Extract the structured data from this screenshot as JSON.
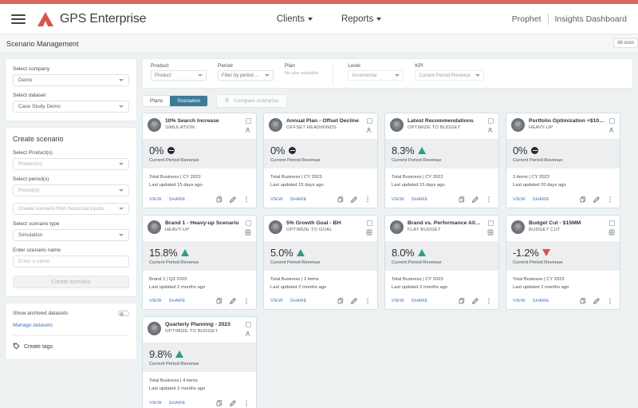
{
  "header": {
    "menu_icon": "hamburger-icon",
    "brand": "GPS Enterprise",
    "nav": [
      {
        "label": "Clients",
        "icon": "chevron-down-icon"
      },
      {
        "label": "Reports",
        "icon": "chevron-down-icon"
      }
    ],
    "right": {
      "prophet": "Prophet",
      "insights": "Insights Dashboard"
    }
  },
  "subheader": {
    "title": "Scenario Management",
    "scope_chip": "All scen"
  },
  "sidebar": {
    "company": {
      "label": "Select company",
      "value": "Demo"
    },
    "dataset": {
      "label": "Select dataset",
      "value": "Case Study Demo"
    },
    "create": {
      "title": "Create scenario",
      "product_label": "Select Product(s)",
      "product_value": "Product(s)",
      "period_label": "Select period(s)",
      "period_value": "Period(s)",
      "historical_value": "Create scenario from historical inputs",
      "type_label": "Select scenario type",
      "type_value": "Simulation",
      "name_label": "Enter scenario name",
      "name_placeholder": "Enter a name",
      "submit_label": "Create scenario"
    },
    "footer": {
      "archived_label": "Show archived datasets",
      "manage_link": "Manage datasets",
      "tags_label": "Create tags",
      "tags_icon": "tag-icon"
    }
  },
  "filters": {
    "product": {
      "label": "Product",
      "value": "Product"
    },
    "period": {
      "label": "Period",
      "value": "Filter by period ..."
    },
    "plan": {
      "label": "Plan",
      "note": "No plan available"
    },
    "level": {
      "label": "Level",
      "value": "Incremental"
    },
    "kpi": {
      "label": "KPI",
      "value": "Current Period Revenue"
    }
  },
  "tabs": {
    "plans": "Plans",
    "scenarios": "Scenarios",
    "active": "Scenarios",
    "compare": "Compare scenarios",
    "compare_icon": "compare-icon"
  },
  "card_actions": {
    "view": "VIEW",
    "share": "SHARE",
    "copy_icon": "copy-icon",
    "edit_icon": "pencil-icon",
    "more_icon": "more-vertical-icon"
  },
  "cards": [
    {
      "title": "10% Search Increase",
      "subtitle": "SIMULATION",
      "value": "0%",
      "trend": "flat",
      "metric_caption": "Current Period Revenue",
      "scope": "Total Business | CY 2023",
      "updated": "Last updated 15 days ago",
      "share_icon": "person-share-icon"
    },
    {
      "title": "Annual Plan - Offset Decline",
      "subtitle": "OFFSET HEADWINDS",
      "value": "0%",
      "trend": "flat",
      "metric_caption": "Current Period Revenue",
      "scope": "Total Business | CY 2023",
      "updated": "Last updated 15 days ago",
      "share_icon": "person-share-icon"
    },
    {
      "title": "Latest Recommendations",
      "subtitle": "OPTIMIZE TO BUDGET",
      "value": "8.3%",
      "trend": "up",
      "metric_caption": "Current Period Revenue",
      "scope": "Total Business | CY 2022",
      "updated": "Last updated 15 days ago",
      "share_icon": "person-share-icon"
    },
    {
      "title": "Portfolio Optimization +$10M...",
      "subtitle": "HEAVY-UP",
      "value": "0%",
      "trend": "flat",
      "metric_caption": "Current Period Revenue",
      "scope": "3 items | CY 2023",
      "updated": "Last updated 20 days ago",
      "share_icon": "person-share-icon"
    },
    {
      "title": "Brand 1 - Heavy-up Scenario",
      "subtitle": "HEAVY-UP",
      "value": "15.8%",
      "trend": "up",
      "metric_caption": "Current Period Revenue",
      "scope": "Brand 1 | Q3 2023",
      "updated": "Last updated 2 months ago",
      "share_icon": "grid-share-icon"
    },
    {
      "title": "5% Growth Goal - BH",
      "subtitle": "OPTIMIZE TO GOAL",
      "value": "5.0%",
      "trend": "up",
      "metric_caption": "Current Period Revenue",
      "scope": "Total Business | 2 items",
      "updated": "Last updated 2 months ago",
      "share_icon": "grid-share-icon"
    },
    {
      "title": "Brand vs. Performance Allocati...",
      "subtitle": "FLAT BUDGET",
      "value": "8.0%",
      "trend": "up",
      "metric_caption": "Current Period Revenue",
      "scope": "Total Business | CY 2023",
      "updated": "Last updated 2 months ago",
      "share_icon": "grid-share-icon"
    },
    {
      "title": "Budget Cut - $15MM",
      "subtitle": "BUDGET CUT",
      "value": "-1.2%",
      "trend": "down",
      "metric_caption": "Current Period Revenue",
      "scope": "Total Business | CY 2023",
      "updated": "Last updated 2 months ago",
      "share_icon": "grid-share-icon"
    },
    {
      "title": "Quarterly Planning - 2023",
      "subtitle": "OPTIMIZE TO BUDGET",
      "value": "9.8%",
      "trend": "up",
      "metric_caption": "Current Period Revenue",
      "scope": "Total Business | 4 items",
      "updated": "Last updated 2 months ago",
      "share_icon": "person-share-icon"
    }
  ],
  "colors": {
    "accent_red": "#d9685f",
    "tab_active": "#3d7b96",
    "link": "#3f73b8",
    "up": "#2e9e85",
    "down": "#d9534a"
  }
}
